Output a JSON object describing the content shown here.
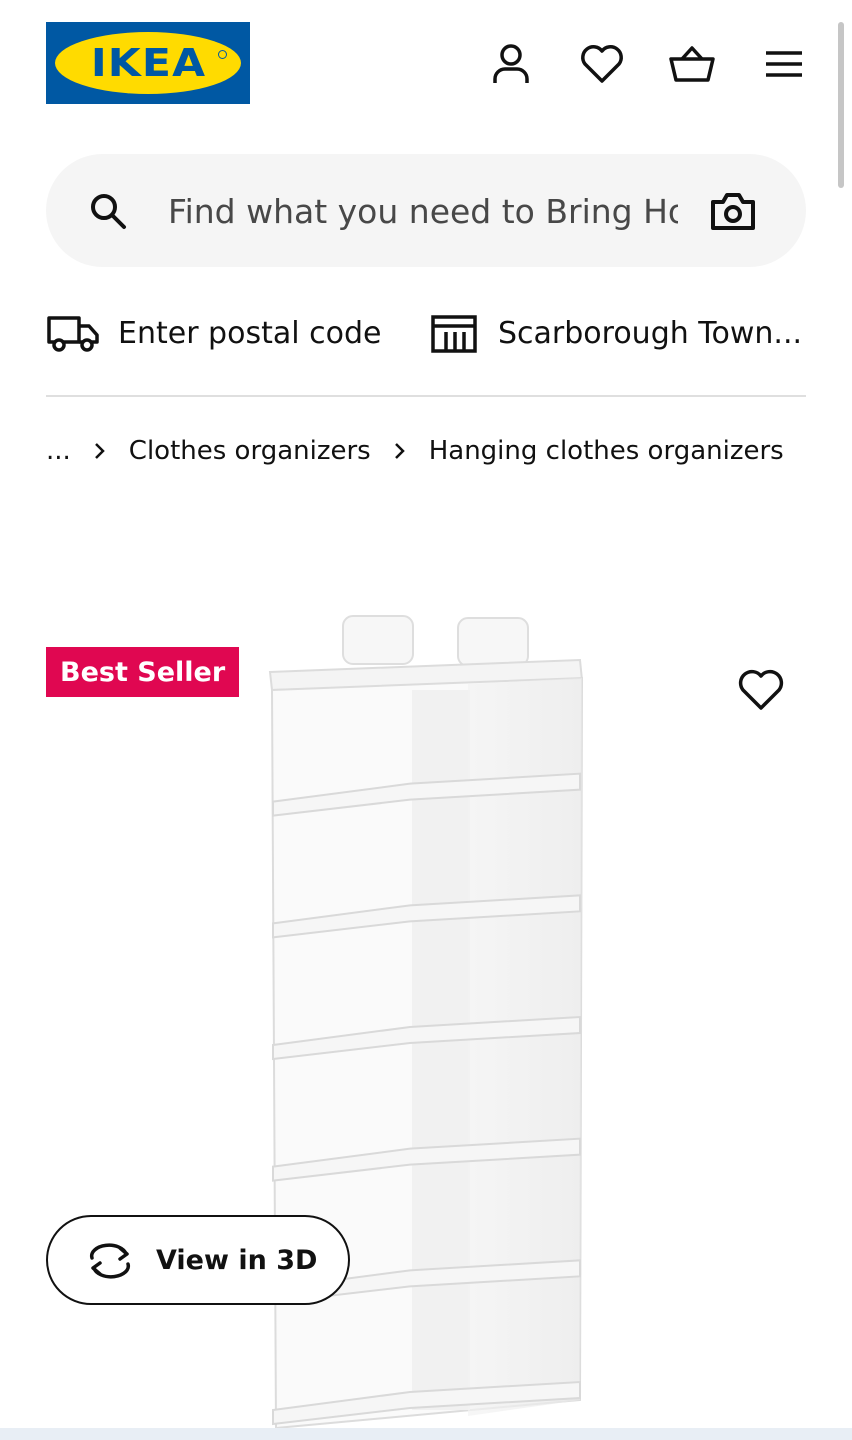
{
  "brand": {
    "logo_text": "IKEA",
    "colors": {
      "blue": "#0058a3",
      "yellow": "#ffdb00",
      "badge": "#e00751"
    }
  },
  "header": {
    "icons": [
      "person-icon",
      "heart-icon",
      "basket-icon",
      "hamburger-menu-icon"
    ]
  },
  "search": {
    "placeholder": "Find what you need to Bring Home"
  },
  "location": {
    "postal_label": "Enter postal code",
    "store_label": "Scarborough Town..."
  },
  "breadcrumb": {
    "ellipsis": "...",
    "items": [
      "Clothes organizers",
      "Hanging clothes organizers"
    ]
  },
  "product": {
    "badge": "Best Seller",
    "view_3d_label": "View in 3D",
    "shelf_count": 6
  }
}
